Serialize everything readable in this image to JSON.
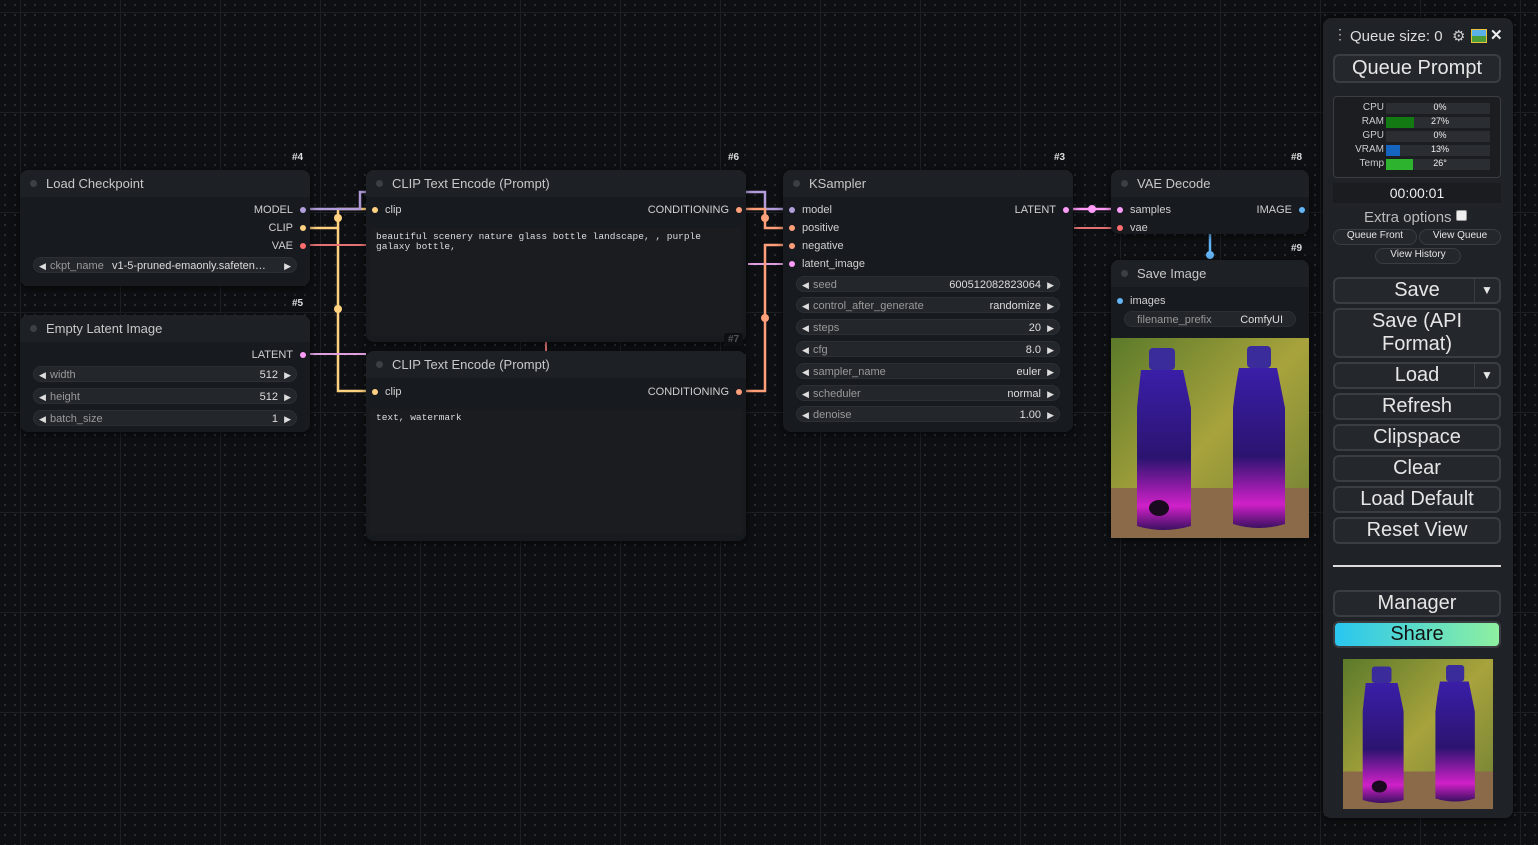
{
  "nodes": {
    "load_checkpoint": {
      "id": "#4",
      "title": "Load Checkpoint",
      "outputs": [
        "MODEL",
        "CLIP",
        "VAE"
      ],
      "ckpt_name_label": "ckpt_name",
      "ckpt_name_value": "v1-5-pruned-emaonly.safeten…"
    },
    "empty_latent": {
      "id": "#5",
      "title": "Empty Latent Image",
      "output": "LATENT",
      "width_label": "width",
      "width_value": "512",
      "height_label": "height",
      "height_value": "512",
      "batch_label": "batch_size",
      "batch_value": "1"
    },
    "clip_pos": {
      "id": "#6",
      "title": "CLIP Text Encode (Prompt)",
      "input": "clip",
      "output": "CONDITIONING",
      "text": "beautiful scenery nature glass bottle landscape, , purple galaxy bottle,"
    },
    "clip_neg": {
      "id": "#7",
      "title": "CLIP Text Encode (Prompt)",
      "input": "clip",
      "output": "CONDITIONING",
      "text": "text, watermark"
    },
    "ksampler": {
      "id": "#3",
      "title": "KSampler",
      "inputs": [
        "model",
        "positive",
        "negative",
        "latent_image"
      ],
      "output": "LATENT",
      "widgets": [
        {
          "label": "seed",
          "value": "600512082823064"
        },
        {
          "label": "control_after_generate",
          "value": "randomize"
        },
        {
          "label": "steps",
          "value": "20"
        },
        {
          "label": "cfg",
          "value": "8.0"
        },
        {
          "label": "sampler_name",
          "value": "euler"
        },
        {
          "label": "scheduler",
          "value": "normal"
        },
        {
          "label": "denoise",
          "value": "1.00"
        }
      ]
    },
    "vae_decode": {
      "id": "#8",
      "title": "VAE Decode",
      "inputs": [
        "samples",
        "vae"
      ],
      "output": "IMAGE"
    },
    "save_image": {
      "id": "#9",
      "title": "Save Image",
      "input": "images",
      "prefix_label": "filename_prefix",
      "prefix_value": "ComfyUI"
    }
  },
  "panel": {
    "queue_size": "Queue size: 0",
    "queue_prompt": "Queue Prompt",
    "monitor": [
      {
        "label": "CPU",
        "value": "0%",
        "fill": 0,
        "color": "#2a8c2a"
      },
      {
        "label": "RAM",
        "value": "27%",
        "fill": 0.27,
        "color": "#137a13"
      },
      {
        "label": "GPU",
        "value": "0%",
        "fill": 0,
        "color": "#2a8c2a"
      },
      {
        "label": "VRAM",
        "value": "13%",
        "fill": 0.13,
        "color": "#1565c0"
      },
      {
        "label": "Temp",
        "value": "26°",
        "fill": 0.26,
        "color": "#2db32d"
      }
    ],
    "timer": "00:00:01",
    "extra_options": "Extra options",
    "queue_front": "Queue Front",
    "view_queue": "View Queue",
    "view_history": "View History",
    "save": "Save",
    "save_api_line1": "Save (API",
    "save_api_line2": "Format)",
    "load": "Load",
    "refresh": "Refresh",
    "clipspace": "Clipspace",
    "clear": "Clear",
    "load_default": "Load Default",
    "reset_view": "Reset View",
    "manager": "Manager",
    "share": "Share"
  },
  "colors": {
    "model": "#b39ddb",
    "clip": "#ffd180",
    "vae": "#ff6e6e",
    "latent": "#ff9cf9",
    "conditioning": "#ffa07a",
    "image": "#64b5f6"
  },
  "icons": [
    "gear-icon",
    "image-icon",
    "close-icon",
    "drag-handle-icon",
    "dropdown-arrow-icon"
  ]
}
